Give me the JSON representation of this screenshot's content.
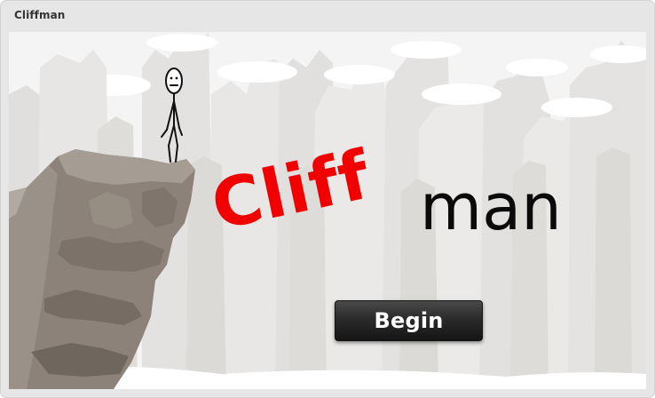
{
  "window": {
    "title": "Cliffman"
  },
  "logo": {
    "part1": "Cliff",
    "part2": "man",
    "part1_color": "#f20000",
    "part2_color": "#0a0a0a"
  },
  "menu": {
    "begin_label": "Begin"
  },
  "colors": {
    "button_bg": "#222222",
    "background_rock": "#e2e0de",
    "cliff": "#8a8076"
  }
}
